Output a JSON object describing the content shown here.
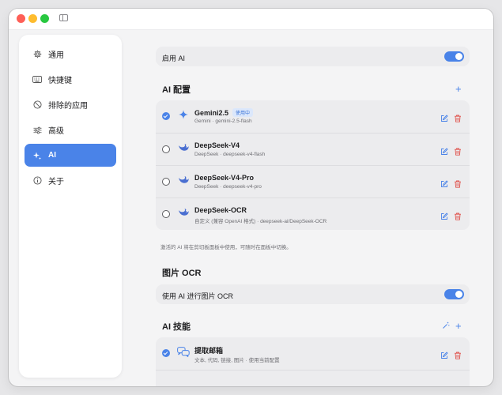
{
  "sidebar": {
    "items": [
      {
        "label": "通用",
        "icon": "gear-icon"
      },
      {
        "label": "快捷键",
        "icon": "keyboard-icon"
      },
      {
        "label": "排除的应用",
        "icon": "prohibited-icon"
      },
      {
        "label": "高级",
        "icon": "sliders-icon"
      },
      {
        "label": "AI",
        "icon": "sparkles-icon"
      },
      {
        "label": "关于",
        "icon": "info-icon"
      }
    ],
    "active": "AI"
  },
  "enable_ai": {
    "label": "启用 AI",
    "on": true
  },
  "ai_config": {
    "title": "AI 配置",
    "add_label": "+",
    "models": [
      {
        "name": "Gemini2.5",
        "badge": "使用中",
        "sub": "Gemini · gemini-2.5-flash",
        "selected": true,
        "icon": "gemini-sparkle-icon"
      },
      {
        "name": "DeepSeek-V4",
        "sub": "DeepSeek · deepseek-v4-flash",
        "selected": false,
        "icon": "deepseek-whale-icon"
      },
      {
        "name": "DeepSeek-V4-Pro",
        "sub": "DeepSeek · deepseek-v4-pro",
        "selected": false,
        "icon": "deepseek-whale-icon"
      },
      {
        "name": "DeepSeek-OCR",
        "sub": "自定义 (兼容 OpenAI 格式) · deepseek-ai/DeepSeek-OCR",
        "selected": false,
        "icon": "deepseek-whale-icon"
      }
    ],
    "note": "激活的 AI 将在剪切板面板中使用，可随时在面板中切换。"
  },
  "image_ocr": {
    "title": "图片 OCR",
    "label": "使用 AI 进行图片 OCR",
    "on": true
  },
  "ai_skills": {
    "title": "AI 技能",
    "add_label": "+",
    "items": [
      {
        "name": "提取邮箱",
        "sub": "文本, 代码, 链接, 图片 · 使用当前配置",
        "selected": true,
        "icon": "chat-bubbles-icon"
      }
    ]
  },
  "colors": {
    "accent": "#4a83e8",
    "delete": "#e0524c"
  }
}
